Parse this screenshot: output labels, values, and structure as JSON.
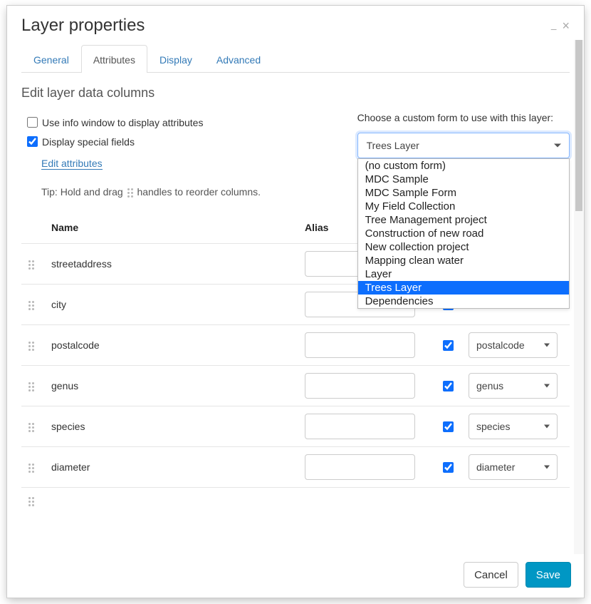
{
  "window": {
    "title": "Layer properties"
  },
  "tabs": [
    {
      "label": "General",
      "active": false
    },
    {
      "label": "Attributes",
      "active": true
    },
    {
      "label": "Display",
      "active": false
    },
    {
      "label": "Advanced",
      "active": false
    }
  ],
  "section_title": "Edit layer data columns",
  "options": {
    "info_window_label": "Use info window to display attributes",
    "special_fields_label": "Display special fields",
    "edit_attributes_label": "Edit attributes",
    "tip_prefix": "Tip: Hold and drag ",
    "tip_suffix": " handles to reorder columns."
  },
  "form_picker": {
    "label": "Choose a custom form to use with this layer:",
    "selected": "Trees Layer",
    "options": [
      "(no custom form)",
      "MDC Sample",
      "MDC Sample Form",
      "My Field Collection",
      "Tree Management project",
      "Construction of new road",
      "New collection project",
      "Mapping clean water",
      "Layer",
      "Trees Layer",
      "Dependencies"
    ]
  },
  "columns": {
    "headers": {
      "name": "Name",
      "alias": "Alias"
    },
    "rows": [
      {
        "name": "streetaddress",
        "alias": "",
        "checked": true,
        "map": ""
      },
      {
        "name": "city",
        "alias": "",
        "checked": true,
        "map": ""
      },
      {
        "name": "postalcode",
        "alias": "",
        "checked": true,
        "map": "postalcode"
      },
      {
        "name": "genus",
        "alias": "",
        "checked": true,
        "map": "genus"
      },
      {
        "name": "species",
        "alias": "",
        "checked": true,
        "map": "species"
      },
      {
        "name": "diameter",
        "alias": "",
        "checked": true,
        "map": "diameter"
      }
    ]
  },
  "footer": {
    "cancel": "Cancel",
    "save": "Save"
  }
}
